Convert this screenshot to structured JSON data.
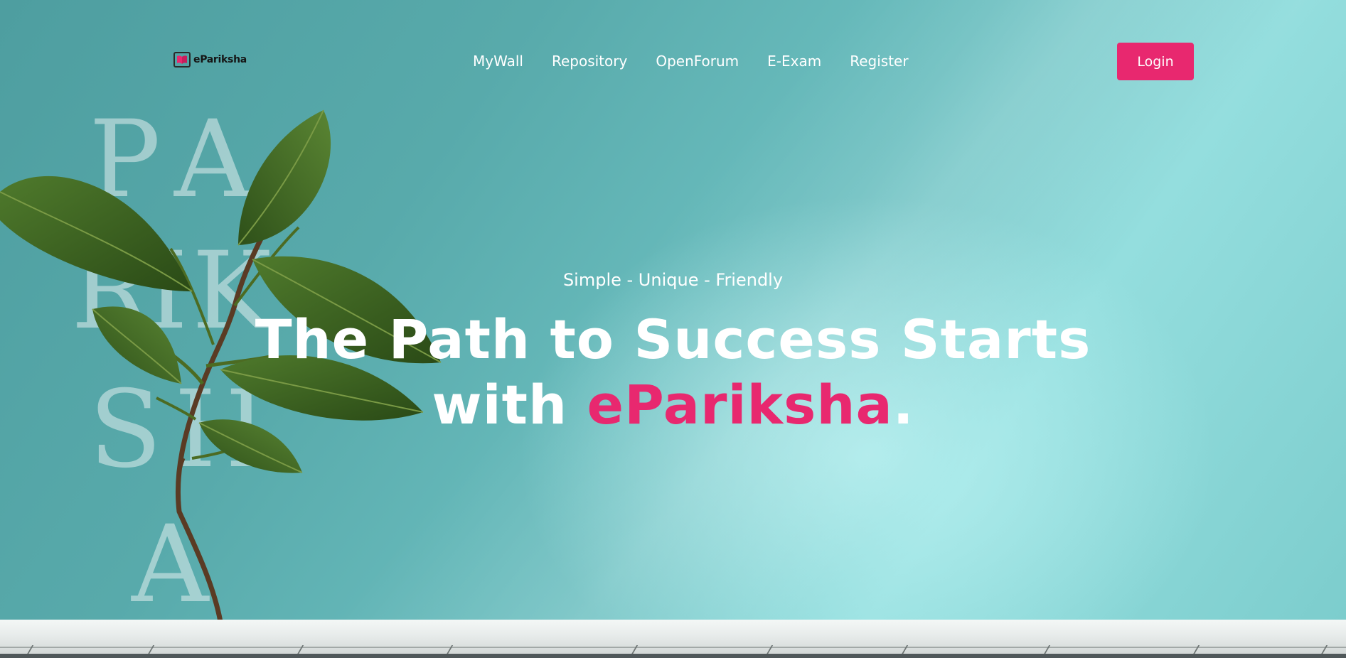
{
  "brand": {
    "logo_text": "eParikshа",
    "logo_icon": "open-book-icon"
  },
  "nav": {
    "items": [
      {
        "label": "MyWall"
      },
      {
        "label": "Repository"
      },
      {
        "label": "OpenForum"
      },
      {
        "label": "E-Exam"
      },
      {
        "label": "Register"
      }
    ],
    "login_label": "Login"
  },
  "hero": {
    "tagline": "Simple - Unique - Friendly",
    "headline_line1": "The Path to Success Starts",
    "headline_with": "with ",
    "headline_brand": "eParikshа",
    "headline_period": ".",
    "watermark_letters": [
      "P",
      "A",
      "R",
      "I",
      "K",
      "S",
      "H",
      "A"
    ]
  },
  "colors": {
    "accent": "#e8286f",
    "background": "#5fb3b3",
    "text": "#ffffff"
  }
}
